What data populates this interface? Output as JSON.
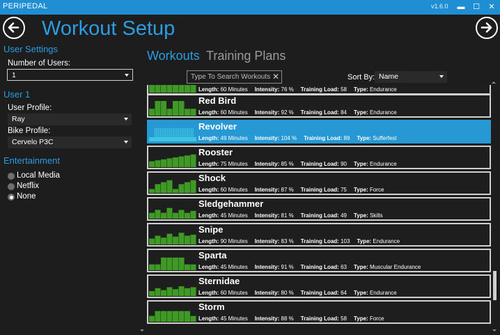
{
  "app": {
    "name": "PERIPEDAL",
    "version": "v1.6.0"
  },
  "window": {
    "minimize": "▬",
    "maximize": "☐",
    "close": "✕"
  },
  "page_title": "Workout Setup",
  "sidebar": {
    "user_settings": "User Settings",
    "num_users_label": "Number of Users:",
    "num_users_value": "1",
    "user_heading": "User 1",
    "user_profile_label": "User Profile:",
    "user_profile_value": "Ray",
    "bike_profile_label": "Bike Profile:",
    "bike_profile_value": "Cervelo P3C",
    "entertainment_heading": "Entertainment",
    "entertainment_options": [
      "Local Media",
      "Netflix",
      "None"
    ],
    "entertainment_selected": "None"
  },
  "tabs": {
    "active": "Workouts",
    "inactive": "Training Plans"
  },
  "search": {
    "placeholder": "Type To Search Workouts",
    "clear": "✕"
  },
  "sort": {
    "label": "Sort By:",
    "value": "Name"
  },
  "meta_labels": {
    "length": "Length:",
    "intensity": "Intensity:",
    "load": "Training Load:",
    "type": "Type:"
  },
  "workouts": [
    {
      "name": "",
      "length": "60 Minutes",
      "intensity": "76 %",
      "load": "58",
      "type": "Endurance",
      "selected": false
    },
    {
      "name": "Red Bird",
      "length": "60 Minutes",
      "intensity": "92 %",
      "load": "84",
      "type": "Endurance",
      "selected": false
    },
    {
      "name": "Revolver",
      "length": "49 Minutes",
      "intensity": "104 %",
      "load": "89",
      "type": "Sufferfest",
      "selected": true
    },
    {
      "name": "Rooster",
      "length": "75 Minutes",
      "intensity": "85 %",
      "load": "90",
      "type": "Endurance",
      "selected": false
    },
    {
      "name": "Shock",
      "length": "60 Minutes",
      "intensity": "87 %",
      "load": "75",
      "type": "Force",
      "selected": false
    },
    {
      "name": "Sledgehammer",
      "length": "45 Minutes",
      "intensity": "81 %",
      "load": "49",
      "type": "Skills",
      "selected": false
    },
    {
      "name": "Snipe",
      "length": "90 Minutes",
      "intensity": "83 %",
      "load": "103",
      "type": "Endurance",
      "selected": false
    },
    {
      "name": "Sparta",
      "length": "45 Minutes",
      "intensity": "91 %",
      "load": "63",
      "type": "Muscular Endurance",
      "selected": false
    },
    {
      "name": "Sternidae",
      "length": "60 Minutes",
      "intensity": "80 %",
      "load": "64",
      "type": "Endurance",
      "selected": false
    },
    {
      "name": "Storm",
      "length": "45 Minutes",
      "intensity": "88 %",
      "load": "58",
      "type": "Force",
      "selected": false
    }
  ],
  "colors": {
    "accent": "#2a9de3",
    "titlebar": "#1f8ed2",
    "selected_row": "#2699d5",
    "spark_green": "#3f9a25",
    "spark_cyan": "#3ec6e0"
  }
}
